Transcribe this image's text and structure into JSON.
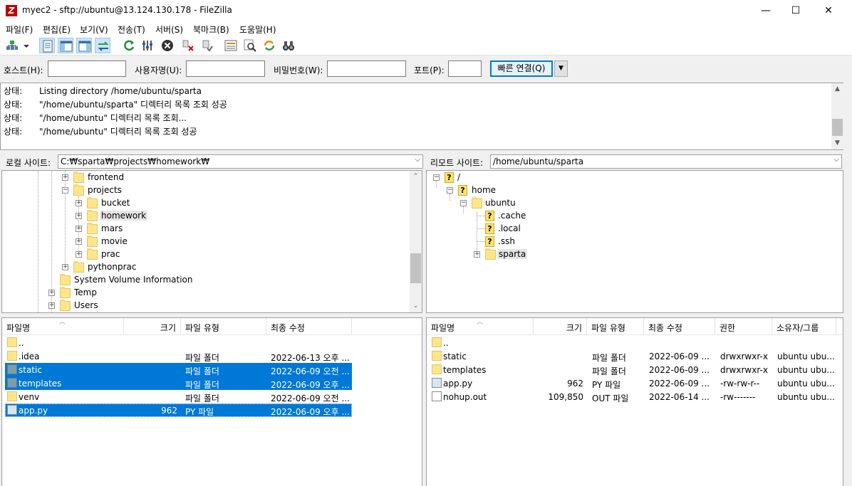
{
  "window": {
    "title": "myec2 - sftp://ubuntu@13.124.130.178 - FileZilla",
    "app_icon_glyph": "Z",
    "minimize": "—",
    "maximize": "☐",
    "close": "✕"
  },
  "menu": [
    "파일(F)",
    "편집(E)",
    "보기(V)",
    "전송(T)",
    "서버(S)",
    "북마크(B)",
    "도움말(H)"
  ],
  "toolbar": {
    "icons": [
      "site-manager-icon",
      "dropdown-arrow-icon",
      "message-log-toggle-icon",
      "local-tree-toggle-icon",
      "remote-tree-toggle-icon",
      "transfer-queue-toggle-icon",
      "refresh-icon",
      "process-queue-icon",
      "cancel-icon",
      "disconnect-icon",
      "reconnect-icon",
      "directory-listing-filter-icon",
      "toggle-comparison-icon",
      "sync-browsing-icon",
      "find-files-icon"
    ]
  },
  "quickconnect": {
    "host_label": "호스트(H):",
    "user_label": "사용자명(U):",
    "pass_label": "비밀번호(W):",
    "port_label": "포트(P):",
    "host_value": "",
    "user_value": "",
    "pass_value": "",
    "port_value": "",
    "button_label": "빠른 연결(Q)",
    "dropdown_glyph": "▼"
  },
  "log": [
    {
      "label": "상태:",
      "text": "Listing directory /home/ubuntu/sparta"
    },
    {
      "label": "상태:",
      "text": "\"/home/ubuntu/sparta\" 디렉터리 목록 조회 성공"
    },
    {
      "label": "상태:",
      "text": "\"/home/ubuntu\" 디렉터리 목록 조회..."
    },
    {
      "label": "상태:",
      "text": "\"/home/ubuntu\" 디렉터리 목록 조회 성공"
    }
  ],
  "local": {
    "site_label": "로컬 사이트:",
    "path": "C:₩sparta₩projects₩homework₩",
    "tree": [
      {
        "label": "frontend",
        "expander": "+"
      },
      {
        "label": "projects",
        "expander": "−"
      },
      {
        "label": "bucket",
        "expander": "+"
      },
      {
        "label": "homework",
        "expander": "+"
      },
      {
        "label": "mars",
        "expander": "+"
      },
      {
        "label": "movie",
        "expander": "+"
      },
      {
        "label": "prac",
        "expander": "+"
      },
      {
        "label": "pythonprac",
        "expander": "+"
      },
      {
        "label": "System Volume Information",
        "expander": ""
      },
      {
        "label": "Temp",
        "expander": "+"
      },
      {
        "label": "Users",
        "expander": "+"
      }
    ],
    "columns": [
      "파일명",
      "크기",
      "파일 유형",
      "최종 수정"
    ],
    "files": [
      {
        "name": "..",
        "size": "",
        "type": "",
        "modified": "",
        "icon": "folder",
        "selected": false
      },
      {
        "name": ".idea",
        "size": "",
        "type": "파일 폴더",
        "modified": "2022-06-13 오후 ...",
        "icon": "folder",
        "selected": false
      },
      {
        "name": "static",
        "size": "",
        "type": "파일 폴더",
        "modified": "2022-06-09 오전 ...",
        "icon": "folder",
        "selected": true
      },
      {
        "name": "templates",
        "size": "",
        "type": "파일 폴더",
        "modified": "2022-06-09 오후 ...",
        "icon": "folder",
        "selected": true
      },
      {
        "name": "venv",
        "size": "",
        "type": "파일 폴더",
        "modified": "2022-06-09 오전 ...",
        "icon": "folder",
        "selected": false
      },
      {
        "name": "app.py",
        "size": "962",
        "type": "PY 파일",
        "modified": "2022-06-09 오후 ...",
        "icon": "py",
        "selected": true
      }
    ]
  },
  "remote": {
    "site_label": "리모트 사이트:",
    "path": "/home/ubuntu/sparta",
    "tree": [
      {
        "label": "/",
        "expander": "−"
      },
      {
        "label": "home",
        "expander": "−"
      },
      {
        "label": "ubuntu",
        "expander": "−"
      },
      {
        "label": ".cache",
        "expander": ""
      },
      {
        "label": ".local",
        "expander": ""
      },
      {
        "label": ".ssh",
        "expander": ""
      },
      {
        "label": "sparta",
        "expander": "+"
      }
    ],
    "columns": [
      "파일명",
      "크기",
      "파일 유형",
      "최종 수정",
      "권한",
      "소유자/그룹"
    ],
    "files": [
      {
        "name": "..",
        "size": "",
        "type": "",
        "modified": "",
        "perms": "",
        "owner": "",
        "icon": "folder"
      },
      {
        "name": "static",
        "size": "",
        "type": "파일 폴더",
        "modified": "2022-06-09 ...",
        "perms": "drwxrwxr-x",
        "owner": "ubuntu ubu...",
        "icon": "folder"
      },
      {
        "name": "templates",
        "size": "",
        "type": "파일 폴더",
        "modified": "2022-06-09 ...",
        "perms": "drwxrwxr-x",
        "owner": "ubuntu ubu...",
        "icon": "folder"
      },
      {
        "name": "app.py",
        "size": "962",
        "type": "PY 파일",
        "modified": "2022-06-09 ...",
        "perms": "-rw-rw-r--",
        "owner": "ubuntu ubu...",
        "icon": "py"
      },
      {
        "name": "nohup.out",
        "size": "109,850",
        "type": "OUT 파일",
        "modified": "2022-06-14 ...",
        "perms": "-rw-------",
        "owner": "ubuntu ubu...",
        "icon": "doc"
      }
    ]
  }
}
